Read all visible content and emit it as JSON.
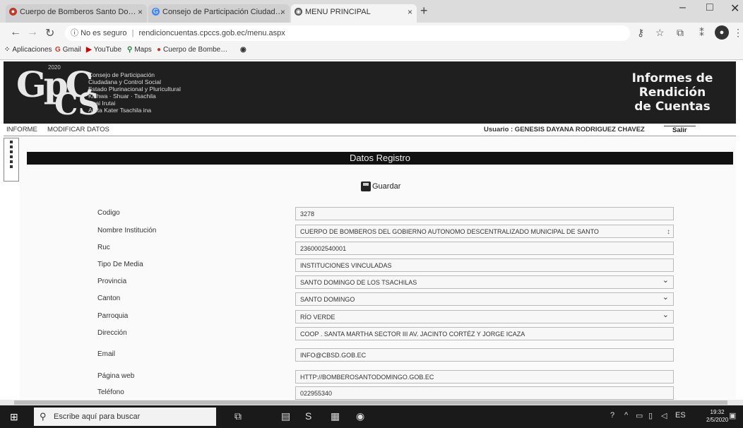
{
  "browser": {
    "tabs": [
      {
        "title": "Cuerpo de Bomberos Santo Do…",
        "icon": "bomberos-favicon-icon",
        "color": "#c0392b"
      },
      {
        "title": "Consejo de Participación Ciudad…",
        "icon": "google-favicon-icon",
        "color": "#4285f4"
      },
      {
        "title": "MENU PRINCIPAL",
        "icon": "chrome-favicon-icon",
        "color": "#555555"
      }
    ],
    "close_glyph": "×",
    "new_tab_glyph": "+",
    "address": {
      "security": "No es seguro",
      "url": "rendicioncuentas.cpccs.gob.ec/menu.aspx"
    },
    "bookmarks": [
      {
        "label": "Aplicaciones",
        "glyph": "⁘"
      },
      {
        "label": "Gmail",
        "glyph": "G"
      },
      {
        "label": "YouTube",
        "glyph": "▶"
      },
      {
        "label": "Maps",
        "glyph": "⚲"
      },
      {
        "label": "Cuerpo de Bombe…",
        "glyph": "●"
      },
      {
        "label": "",
        "glyph": "◉"
      }
    ]
  },
  "site": {
    "logo_year": "2020",
    "logo_lines": [
      "Consejo de Participación",
      "Ciudadana y Control Social",
      "Estado Plurinacional y Pluricultural",
      "Kichwa · Shuar · Tsachila",
      "Uyai Irutai",
      "Amta Kater Tsachila ina"
    ],
    "logo_letters_top": "GpC",
    "logo_letters_bottom": "CS",
    "title_lines": [
      "Informes de",
      "Rendición",
      "de Cuentas"
    ],
    "menu": [
      "INFORME",
      "MODIFICAR DATOS"
    ],
    "user": "Usuario : GENESIS DAYANA RODRIGUEZ CHAVEZ",
    "logout": "Salir"
  },
  "form": {
    "section_title": "Datos Registro",
    "save_label": "Guardar",
    "fields": [
      {
        "label": "Codigo",
        "value": "3278"
      },
      {
        "label": "Nombre Institución",
        "value": "CUERPO DE BOMBEROS DEL GOBIERNO AUTONOMO DESCENTRALIZADO MUNICIPAL DE SANTO"
      },
      {
        "label": "Ruc",
        "value": "2360002540001"
      },
      {
        "label": "Tipo De Media",
        "value": "INSTITUCIONES VINCULADAS"
      },
      {
        "label": "Provincia",
        "value": "SANTO DOMINGO DE LOS TSACHILAS"
      },
      {
        "label": "Canton",
        "value": "SANTO DOMINGO"
      },
      {
        "label": "Parroquia",
        "value": "RÍO VERDE"
      },
      {
        "label": "Dirección",
        "value": "COOP . SANTA MARTHA SECTOR III AV. JACINTO CORTÉZ Y JORGE ICAZA"
      },
      {
        "label": "Email",
        "value": "INFO@CBSD.GOB.EC"
      },
      {
        "label": "Página web",
        "value": "HTTP://BOMBEROSANTODOMINGO.GOB.EC"
      },
      {
        "label": "Teléfono",
        "value": "022955340"
      }
    ]
  },
  "taskbar": {
    "search_placeholder": "Escribe aquí para buscar",
    "time": "19:32",
    "date": "2/5/2020"
  }
}
